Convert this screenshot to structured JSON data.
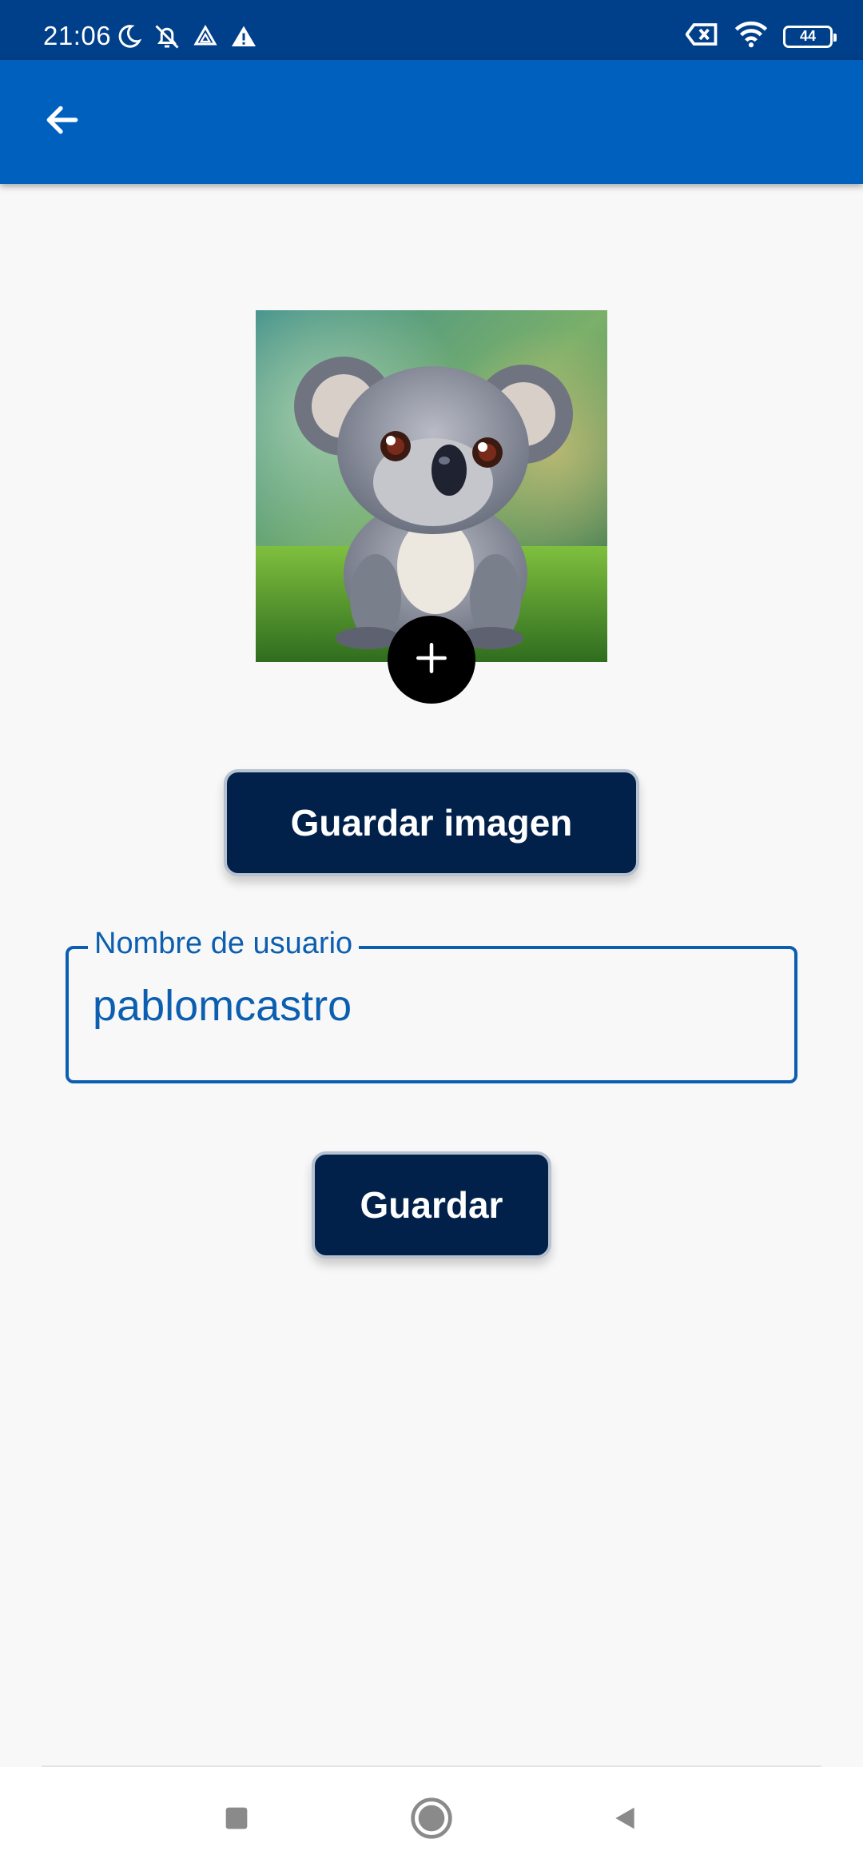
{
  "status_bar": {
    "time": "21:06",
    "battery_level": "44",
    "left_icons": [
      "moon-icon",
      "bell-off-icon",
      "drive-icon",
      "warning-icon"
    ],
    "right_icons": [
      "sim-error-icon",
      "wifi-icon",
      "battery-icon"
    ]
  },
  "app_bar": {
    "back_icon": "arrow-back-icon",
    "color": "#0060be"
  },
  "profile": {
    "image_alt": "koala",
    "add_icon": "plus-icon"
  },
  "buttons": {
    "save_image_label": "Guardar imagen",
    "save_label": "Guardar"
  },
  "username_field": {
    "label": "Nombre de usuario",
    "value": "pablomcastro"
  },
  "nav_bar": {
    "recents_icon": "square-icon",
    "home_icon": "circle-icon",
    "back_icon": "triangle-back-icon"
  },
  "colors": {
    "status_bar": "#003f8a",
    "accent": "#0c5fb0",
    "button_bg": "#01204a",
    "background": "#f8f8f9"
  }
}
